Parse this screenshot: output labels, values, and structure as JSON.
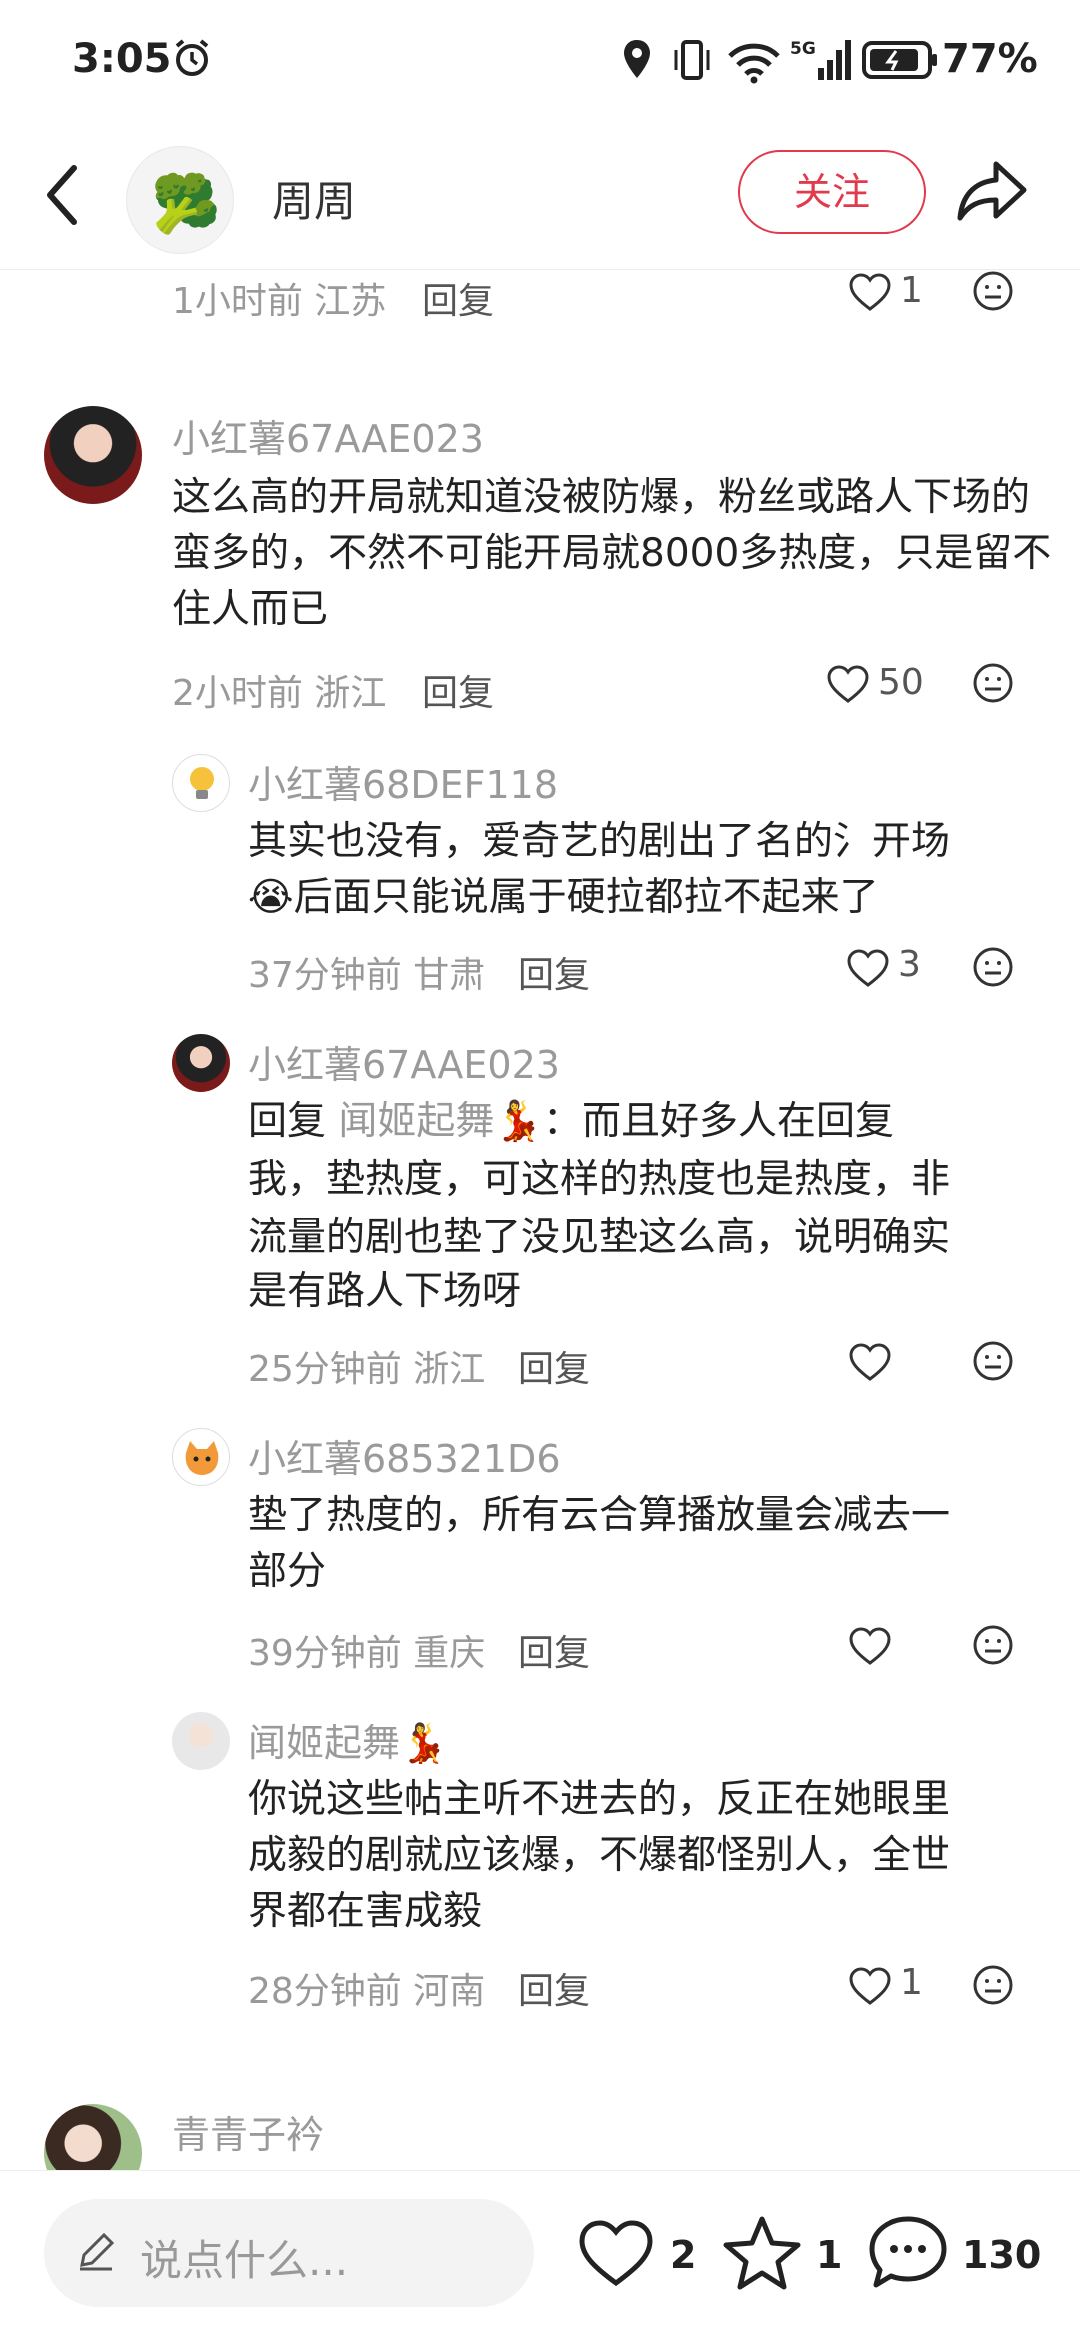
{
  "status_bar": {
    "time": "3:05",
    "battery": "77%"
  },
  "header": {
    "author": "周周",
    "follow_label": "关注"
  },
  "prev_comment": {
    "time": "1小时前",
    "location": "江苏",
    "reply": "回复",
    "likes": "1"
  },
  "comments": [
    {
      "username": "小红薯67AAE023",
      "text": "这么高的开局就知道没被防爆，粉丝或路人下场的蛮多的，不然不可能开局就8000多热度，只是留不住人而已",
      "time": "2小时前",
      "location": "浙江",
      "reply": "回复",
      "likes": "50"
    }
  ],
  "replies": [
    {
      "username": "小红薯68DEF118",
      "text_lines": [
        "其实也没有，爱奇艺的剧出了名的氵开场",
        "😭后面只能说属于硬拉都拉不起来了"
      ],
      "time": "37分钟前",
      "location": "甘肃",
      "reply": "回复",
      "likes": "3"
    },
    {
      "username": "小红薯67AAE023",
      "reply_prefix": "回复",
      "reply_target": "闻姬起舞💃",
      "reply_colon": "：",
      "text_lines": [
        "而且好多人在回复",
        "我，垫热度，可这样的热度也是热度，非",
        "流量的剧也垫了没见垫这么高，说明确实",
        "是有路人下场呀"
      ],
      "time": "25分钟前",
      "location": "浙江",
      "reply": "回复",
      "likes": ""
    },
    {
      "username": "小红薯685321D6",
      "text_lines": [
        "垫了热度的，所有云合算播放量会减去一",
        "部分"
      ],
      "time": "39分钟前",
      "location": "重庆",
      "reply": "回复",
      "likes": ""
    },
    {
      "username": "闻姬起舞💃",
      "text_lines": [
        "你说这些帖主听不进去的，反正在她眼里",
        "成毅的剧就应该爆，不爆都怪别人，全世",
        "界都在害成毅"
      ],
      "time": "28分钟前",
      "location": "河南",
      "reply": "回复",
      "likes": "1"
    }
  ],
  "next_comment": {
    "username": "青青子衿"
  },
  "bottom_bar": {
    "input_placeholder": "说点什么...",
    "likes": "2",
    "favorites": "1",
    "comments": "130"
  },
  "colors": {
    "accent": "#e23a4d",
    "muted": "#999999"
  }
}
